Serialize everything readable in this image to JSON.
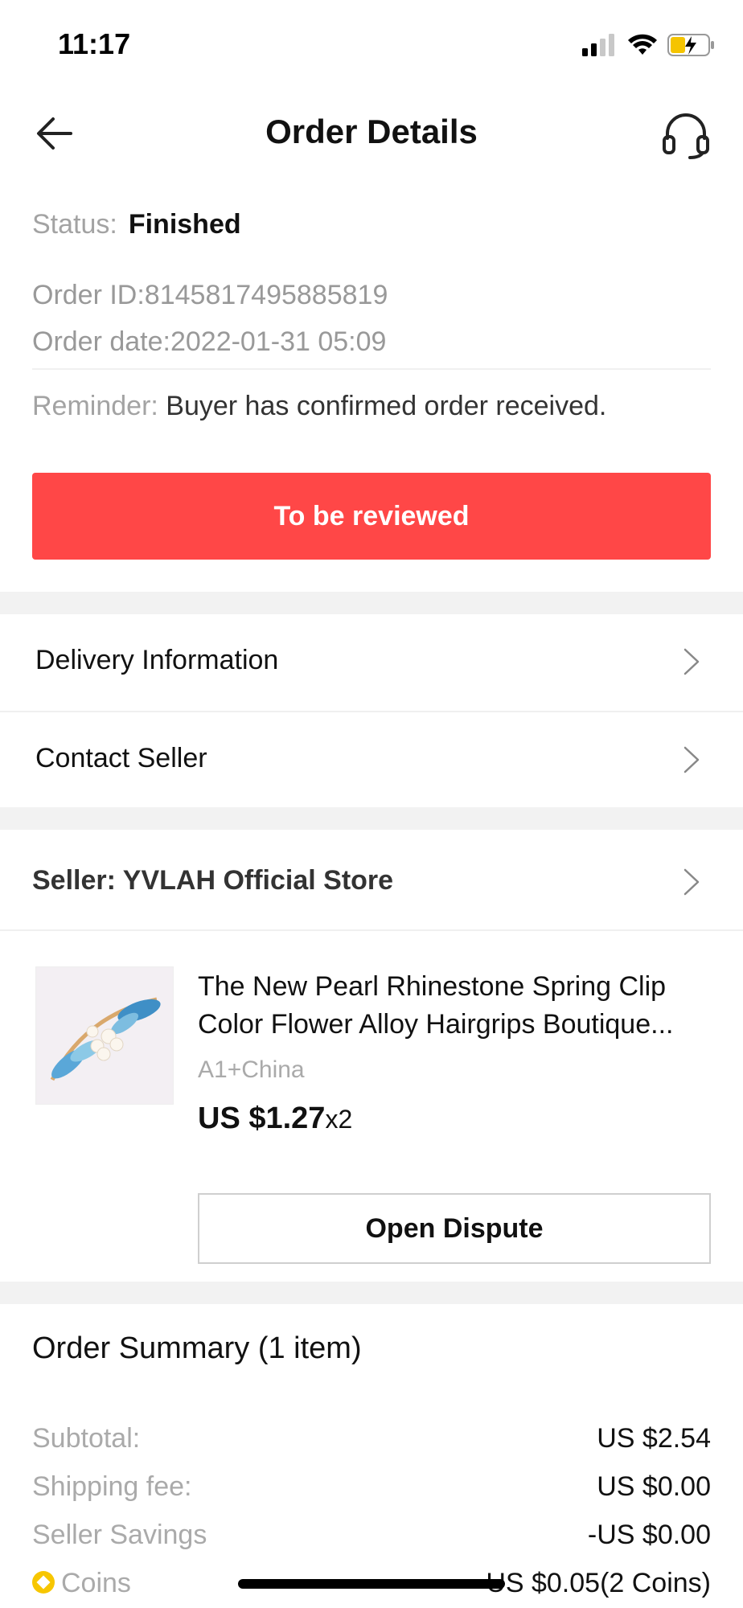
{
  "status_bar": {
    "time": "11:17"
  },
  "header": {
    "title": "Order Details"
  },
  "order": {
    "status_label": "Status:",
    "status_value": "Finished",
    "order_id": "Order ID:8145817495885819",
    "order_date": "Order date:2022-01-31 05:09",
    "reminder_label": "Reminder:",
    "reminder_text": "Buyer has confirmed order received.",
    "review_button": "To be reviewed"
  },
  "links": {
    "delivery": "Delivery Information",
    "contact": "Contact Seller"
  },
  "seller": {
    "label": "Seller: YVLAH Official Store"
  },
  "product": {
    "title_line1": "The New Pearl Rhinestone Spring Clip",
    "title_line2": "Color Flower Alloy Hairgrips Boutique...",
    "variant": "A1+China",
    "price": "US $1.27",
    "quantity": "x2",
    "dispute_button": "Open Dispute"
  },
  "summary": {
    "title": "Order Summary (1 item)",
    "rows": [
      {
        "label": "Subtotal:",
        "value": "US $2.54"
      },
      {
        "label": "Shipping fee:",
        "value": "US $0.00"
      },
      {
        "label": "Seller Savings",
        "value": "-US $0.00"
      },
      {
        "label": "Coins",
        "value": "US $0.05(2 Coins)"
      }
    ]
  },
  "colors": {
    "accent": "#ff4747",
    "coin": "#f7c600"
  }
}
